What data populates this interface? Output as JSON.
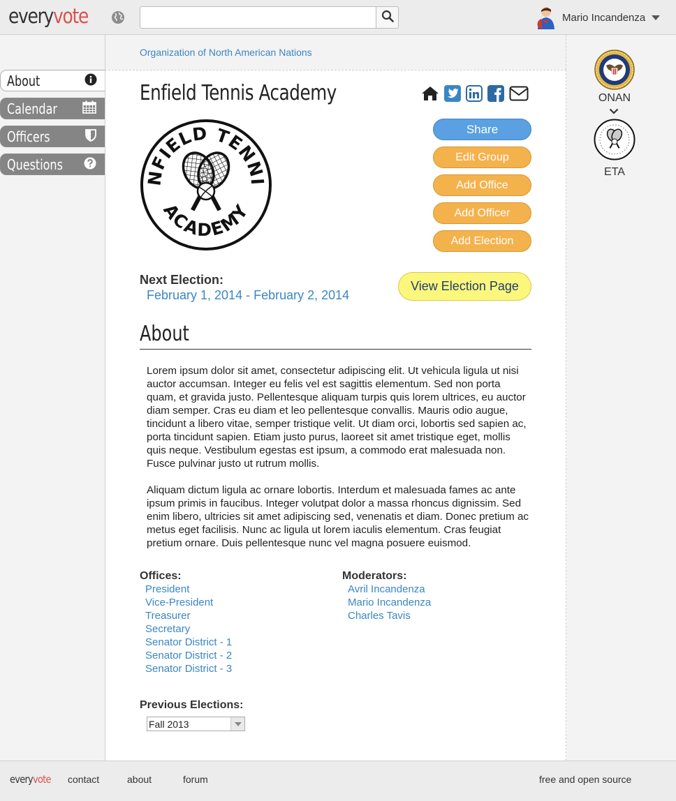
{
  "header": {
    "logo_part1": "every",
    "logo_part2": "vote",
    "search_placeholder": "",
    "user_name": "Mario Incandenza",
    "icons": [
      "globe-icon",
      "search-icon",
      "avatar",
      "caret-down-icon"
    ]
  },
  "breadcrumb": "Organization of North American Nations",
  "sidebar": {
    "items": [
      {
        "label": "About",
        "icon": "info-icon",
        "active": true
      },
      {
        "label": "Calendar",
        "icon": "calendar-icon",
        "active": false
      },
      {
        "label": "Officers",
        "icon": "shield-icon",
        "active": false
      },
      {
        "label": "Questions",
        "icon": "question-icon",
        "active": false
      }
    ]
  },
  "group": {
    "title": "Enfield Tennis Academy",
    "social_icons": [
      "home-icon",
      "twitter-icon",
      "linkedin-icon",
      "facebook-icon",
      "email-icon"
    ],
    "emblem_top_text": "ENFIELD TENNIS",
    "emblem_bottom_text": "ACADEMY"
  },
  "actions": {
    "share": "Share",
    "edit_group": "Edit Group",
    "add_office": "Add Office",
    "add_officer": "Add Officer",
    "add_election": "Add Election"
  },
  "election": {
    "label": "Next Election:",
    "dates": "February 1, 2014 - February 2, 2014",
    "view_button": "View Election Page"
  },
  "about": {
    "heading": "About",
    "paragraphs": [
      "Lorem ipsum dolor sit amet, consectetur adipiscing elit. Ut vehicula ligula ut nisi auctor accumsan. Integer eu felis vel est sagittis elementum. Sed non porta quam, et gravida justo. Pellentesque aliquam turpis quis lorem ultrices, eu auctor diam semper. Cras eu diam et leo pellentesque convallis. Mauris odio augue, tincidunt a libero vitae, semper tristique velit. Ut diam orci, lobortis sed sapien ac, porta tincidunt sapien. Etiam justo purus, laoreet sit amet tristique eget, mollis quis neque. Vestibulum egestas est ipsum, a commodo erat malesuada non. Fusce pulvinar justo ut rutrum mollis.",
      "Aliquam dictum ligula ac ornare lobortis. Interdum et malesuada fames ac ante ipsum primis in faucibus. Integer volutpat dolor a massa rhoncus dignissim. Sed enim libero, ultricies sit amet adipiscing sed, venenatis et diam. Donec pretium ac metus eget facilisis. Nunc ac ligula ut lorem iaculis elementum. Cras feugiat pretium ornare. Duis pellentesque nunc vel magna posuere euismod."
    ]
  },
  "offices": {
    "label": "Offices:",
    "items": [
      "President",
      "Vice-President",
      "Treasurer",
      "Secretary",
      "Senator District - 1",
      "Senator District - 2",
      "Senator District - 3"
    ]
  },
  "moderators": {
    "label": "Moderators:",
    "items": [
      "Avril Incandenza",
      "Mario Incandenza",
      "Charles Tavis"
    ]
  },
  "previous_elections": {
    "label": "Previous Elections:",
    "selected": "Fall 2013"
  },
  "right_column": {
    "orgs": [
      {
        "short": "ONAN",
        "logo": "onan-seal"
      },
      {
        "short": "ETA",
        "logo": "eta-emblem"
      }
    ]
  },
  "footer": {
    "logo_part1": "every",
    "logo_part2": "vote",
    "links": [
      "contact",
      "about",
      "forum"
    ],
    "right_text": "free and open source"
  },
  "colors": {
    "link": "#3a86c4",
    "share_button": "#5aa0e2",
    "action_button": "#f4b24d",
    "election_button": "#fbf77c",
    "logo_accent": "#d9534f",
    "sidebar_item": "#858585"
  }
}
